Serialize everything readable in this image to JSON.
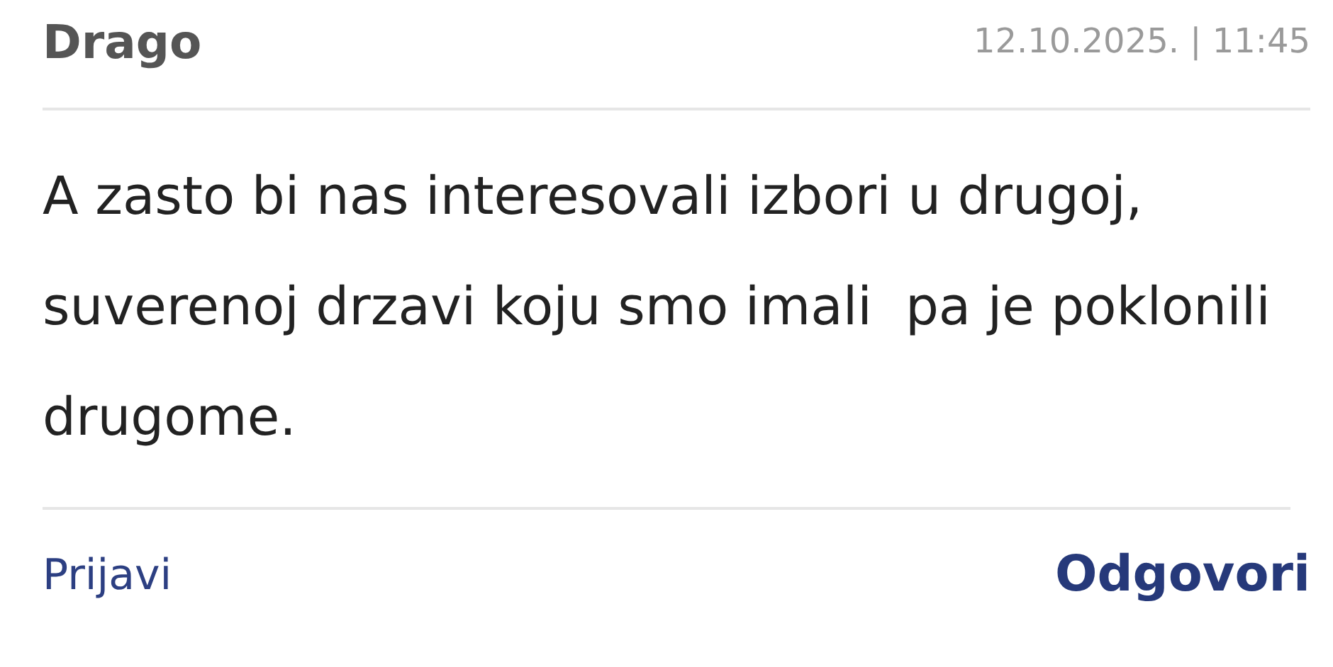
{
  "comment": {
    "author": "Drago",
    "timestamp": "12.10.2025. | 11:45",
    "text": "A zasto bi nas interesovali izbori u drugoj, suverenoj drzavi koju smo imali  pa je poklonili drugome."
  },
  "actions": {
    "report": "Prijavi",
    "reply": "Odgovori"
  }
}
